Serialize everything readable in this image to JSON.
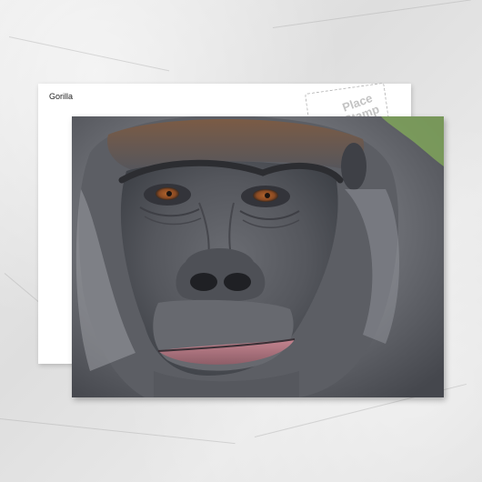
{
  "postcard": {
    "title": "Gorilla",
    "stamp_text": "Place Stamp Here"
  },
  "colors": {
    "background": "#e6e6e6",
    "card_back": "#ffffff",
    "fur_dark": "#3f4248",
    "fur_light": "#8e9096",
    "skin": "#5e6068",
    "brow_fur": "#7b5b45",
    "eye": "#8a4a22",
    "lips": "#b0707a",
    "foliage": "#7fa35b"
  }
}
